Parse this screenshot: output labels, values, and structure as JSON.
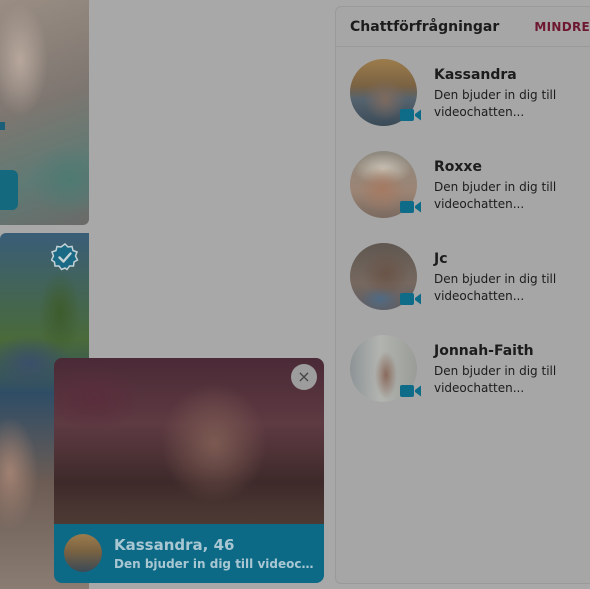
{
  "panel": {
    "title": "Chattförfrågningar",
    "less_label": "MINDRE"
  },
  "requests": [
    {
      "name": "Kassandra",
      "message": "Den bjuder in dig till videochatten..."
    },
    {
      "name": "Roxxe",
      "message": "Den bjuder in dig till videochatten..."
    },
    {
      "name": "Jc",
      "message": "Den bjuder in dig till videochatten..."
    },
    {
      "name": "Jonnah-Faith",
      "message": "Den bjuder in dig till videochatten..."
    }
  ],
  "popup": {
    "name_age": "Kassandra, 46",
    "message": "Den bjuder in dig till videochatten...",
    "close_glyph": "×"
  },
  "icons": {
    "camera": "video-camera-icon",
    "verified": "verified-badge-icon",
    "close": "close-icon"
  },
  "colors": {
    "accent_teal": "#0d6a86",
    "less_link": "#6e1730",
    "overlay_bg": "#a8a8a8"
  }
}
